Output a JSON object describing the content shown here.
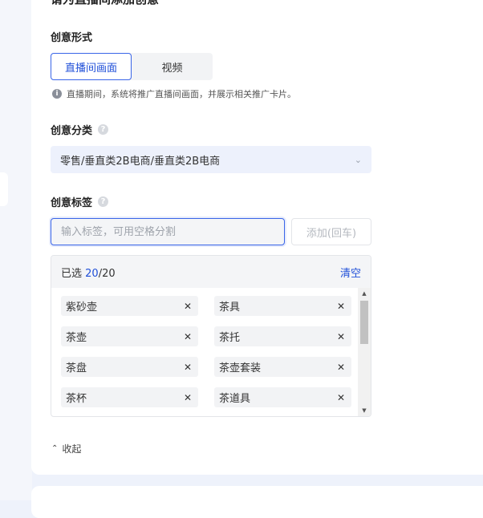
{
  "section": {
    "heading": "请为直播间添加创意"
  },
  "creative_form": {
    "label": "创意形式",
    "options": [
      {
        "label": "直播间画面",
        "active": true
      },
      {
        "label": "视频",
        "active": false
      }
    ],
    "hint": "直播期间，系统将推广直播间画面，并展示相关推广卡片。"
  },
  "category": {
    "label": "创意分类",
    "value": "零售/垂直类2B电商/垂直类2B电商"
  },
  "tags": {
    "label": "创意标签",
    "input_placeholder": "输入标签，可用空格分割",
    "add_button": "添加(回车)",
    "selected_prefix": "已选 ",
    "selected_count": "20",
    "selected_max": "/20",
    "clear_label": "清空",
    "items": [
      "紫砂壶",
      "茶具",
      "茶壶",
      "茶托",
      "茶盘",
      "茶壶套装",
      "茶杯",
      "茶道具"
    ]
  },
  "collapse_label": "收起",
  "colors": {
    "accent": "#1f4fd8",
    "page_bg": "#eef2fb"
  }
}
